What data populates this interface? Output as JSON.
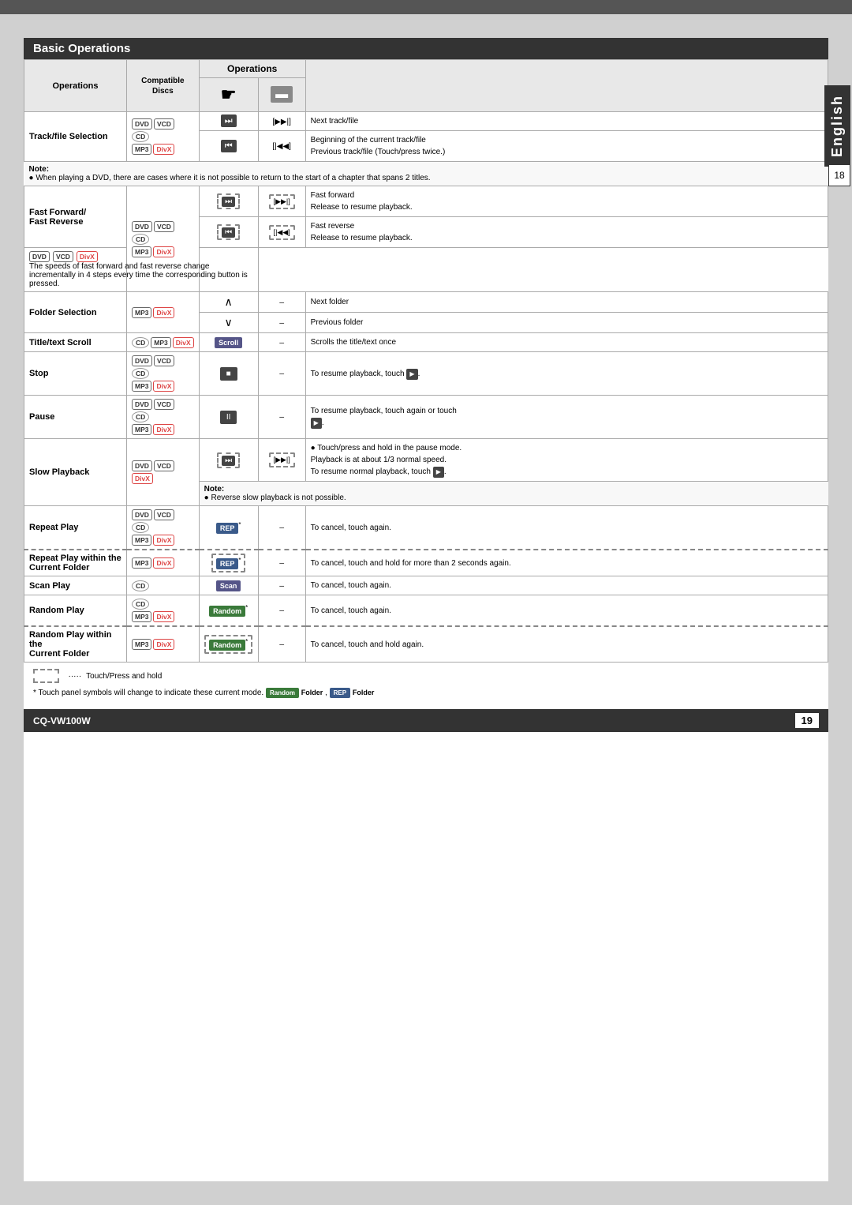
{
  "page": {
    "title": "Basic Operations",
    "language_tab": "English",
    "page_number_side": "18",
    "page_number_bottom": "19",
    "model": "CQ-VW100W"
  },
  "table": {
    "header": {
      "operations_label": "Operations",
      "compatible_discs_label": "Compatible Discs",
      "touch_panel_label": "Touch Panel",
      "remote_label": "Remote"
    },
    "rows": [
      {
        "id": "track-selection",
        "label": "Track/file Selection",
        "discs": "DVD VCD CD MP3 DivX",
        "touch1": "⏭",
        "touch2": "⏮",
        "remote1": "[▶▶|]",
        "remote2": "[|◀◀]",
        "desc1": "Next track/file",
        "desc2": "Beginning of the current track/file",
        "desc3": "Previous track/file (Touch/press twice.)"
      },
      {
        "id": "fast-forward",
        "label": "Fast Forward/ Fast Reverse",
        "discs": "DVD VCD CD MP3 DivX",
        "desc": "Fast forward\nRelease to resume playback.\nFast reverse\nRelease to resume playback.",
        "note": "The speeds of fast forward and fast reverse change incrementally in 4 steps every time the corresponding button is pressed."
      },
      {
        "id": "folder-selection",
        "label": "Folder Selection",
        "discs": "MP3 DivX",
        "touch1": "∧",
        "touch2": "∨",
        "remote1": "–",
        "desc1": "Next folder",
        "desc2": "Previous folder"
      },
      {
        "id": "title-scroll",
        "label": "Title/text Scroll",
        "discs": "CD MP3 DivX",
        "touch": "Scroll",
        "remote": "–",
        "desc": "Scrolls the title/text once"
      },
      {
        "id": "stop",
        "label": "Stop",
        "discs": "DVD VCD CD MP3 DivX",
        "touch": "■",
        "remote": "–",
        "desc": "To resume playback, touch ▶."
      },
      {
        "id": "pause",
        "label": "Pause",
        "discs": "DVD VCD CD MP3 DivX",
        "touch": "II",
        "remote": "–",
        "desc": "To resume playback, touch again or touch ▶."
      },
      {
        "id": "slow-playback",
        "label": "Slow Playback",
        "discs": "DVD VCD DivX",
        "desc": "• Touch/press and hold in the pause mode.\nPlayback is at about 1/3 normal speed.\nTo resume normal playback, touch ▶.",
        "note": "• Reverse slow playback is not possible."
      },
      {
        "id": "repeat-play",
        "label": "Repeat Play",
        "discs": "DVD VCD CD MP3 DivX",
        "touch": "REP",
        "remote": "–",
        "desc": "To cancel, touch again."
      },
      {
        "id": "repeat-play-folder",
        "label": "Repeat Play within the Current Folder",
        "discs": "MP3 DivX",
        "touch": "REP",
        "remote": "–",
        "desc": "To cancel, touch and hold for more than 2 seconds again.",
        "dashed": true
      },
      {
        "id": "scan-play",
        "label": "Scan Play",
        "discs": "CD",
        "touch": "Scan",
        "remote": "–",
        "desc": "To cancel, touch again."
      },
      {
        "id": "random-play",
        "label": "Random Play",
        "discs": "CD MP3 DivX",
        "touch": "Random",
        "remote": "–",
        "desc": "To cancel, touch again."
      },
      {
        "id": "random-play-folder",
        "label": "Random Play within the Current Folder",
        "discs": "MP3 DivX",
        "touch": "Random",
        "remote": "–",
        "desc": "To cancel, touch and hold again.",
        "dashed": true
      }
    ]
  },
  "footer": {
    "legend_text": "Touch/Press and hold",
    "note_text": "* Touch panel symbols will change to indicate these current mode.",
    "random_folder": "Random Folder",
    "rep_folder": "REP Folder"
  },
  "notes": {
    "track_note": "When playing a DVD, there are cases where it is not possible to return to the start of a chapter that spans 2 titles.",
    "slow_note": "Reverse slow playback is not possible."
  }
}
